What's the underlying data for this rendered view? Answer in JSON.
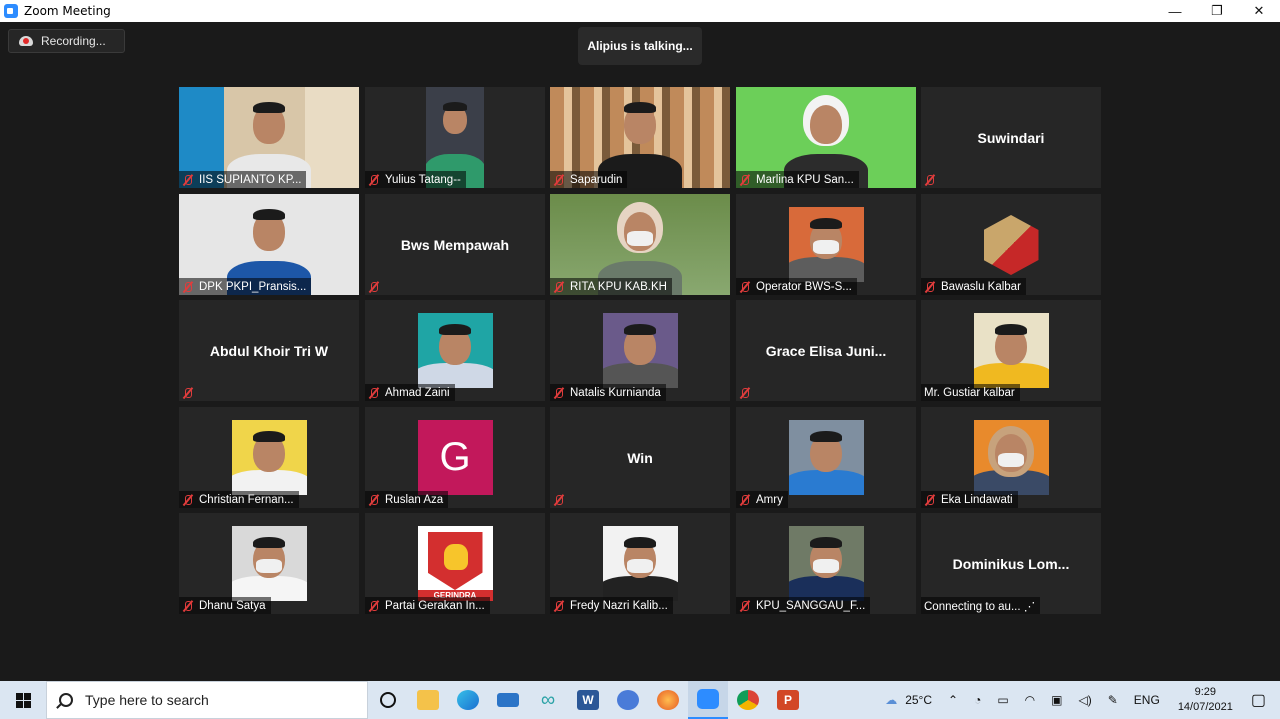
{
  "window": {
    "title": "Zoom Meeting",
    "controls": [
      "—",
      "❐",
      "✕"
    ]
  },
  "recording": {
    "label": "Recording..."
  },
  "talking": {
    "text": "Alipius is talking..."
  },
  "tiles": [
    {
      "name": "IIS SUPIANTO KP...",
      "muted": true,
      "video": true
    },
    {
      "name": "Yulius Tatang--",
      "muted": true,
      "video": true
    },
    {
      "name": "Saparudin",
      "muted": true,
      "video": true
    },
    {
      "name": "Marlina KPU San...",
      "muted": true,
      "video": true
    },
    {
      "name": "",
      "display_name": "Suwindari",
      "muted": true,
      "video": false
    },
    {
      "name": "DPK PKPI_Pransis...",
      "muted": true,
      "video": true
    },
    {
      "name": "",
      "display_name": "Bws Mempawah",
      "muted": true,
      "video": false
    },
    {
      "name": "RITA KPU KAB.KH",
      "muted": true,
      "video": true
    },
    {
      "name": "Operator BWS-S...",
      "muted": true,
      "video": true
    },
    {
      "name": "Bawaslu Kalbar",
      "muted": true,
      "video": true
    },
    {
      "name": "",
      "display_name": "Abdul Khoir Tri W",
      "muted": true,
      "video": false
    },
    {
      "name": "Ahmad Zaini",
      "muted": true,
      "video": true
    },
    {
      "name": "Natalis Kurnianda",
      "muted": true,
      "video": true
    },
    {
      "name": "",
      "display_name": "Grace Elisa Juni...",
      "muted": true,
      "video": false
    },
    {
      "name": "Mr. Gustiar kalbar",
      "muted": false,
      "video": true
    },
    {
      "name": "Christian Fernan...",
      "muted": true,
      "video": true
    },
    {
      "name": "Ruslan Aza",
      "muted": true,
      "video": true,
      "avatar_letter": "G"
    },
    {
      "name": "",
      "display_name": "Win",
      "muted": true,
      "video": false
    },
    {
      "name": "Amry",
      "muted": true,
      "video": true
    },
    {
      "name": "Eka Lindawati",
      "muted": true,
      "video": true
    },
    {
      "name": "Dhanu Satya",
      "muted": true,
      "video": true
    },
    {
      "name": "Partai Gerakan In...",
      "muted": true,
      "video": true,
      "logo_text": "GERINDRA"
    },
    {
      "name": "Fredy Nazri Kalib...",
      "muted": true,
      "video": true
    },
    {
      "name": "KPU_SANGGAU_F...",
      "muted": true,
      "video": true
    },
    {
      "name": "Connecting to au... ⋰",
      "display_name": "Dominikus Lom...",
      "muted": false,
      "video": false
    }
  ],
  "taskbar": {
    "search_placeholder": "Type here to search",
    "weather": "25°C",
    "language": "ENG",
    "time": "9:29",
    "date": "14/07/2021"
  }
}
